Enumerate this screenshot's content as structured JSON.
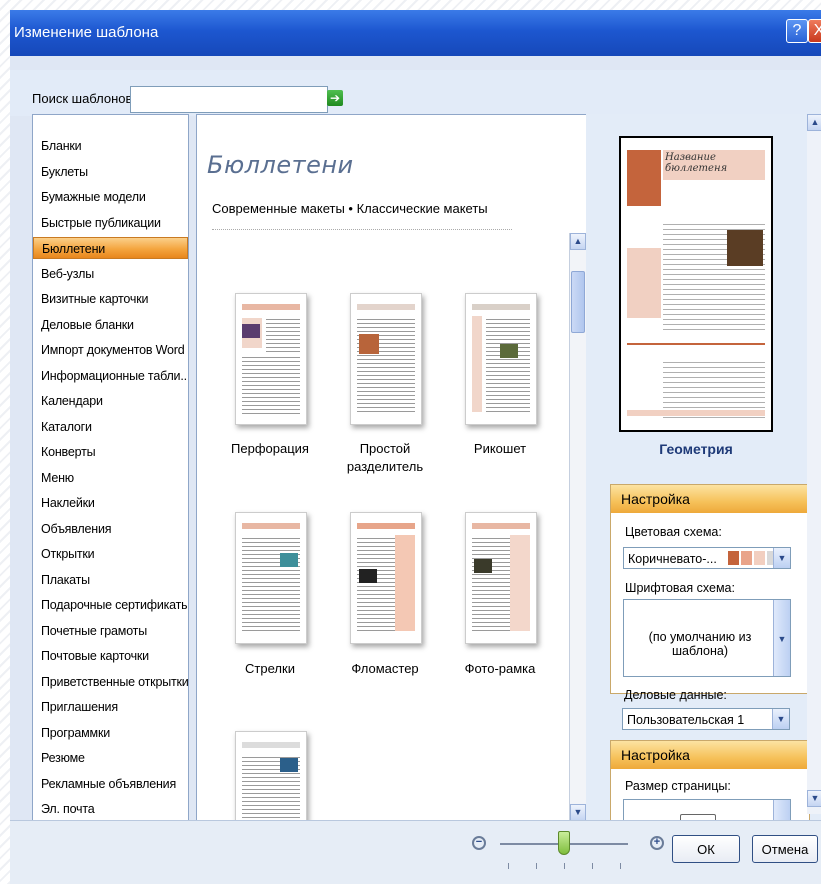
{
  "window": {
    "title": "Изменение шаблона",
    "help_label": "?",
    "close_label": "X"
  },
  "search": {
    "label": "Поиск шаблонов:",
    "value": "",
    "go_label": "➔"
  },
  "categories": [
    "Бланки",
    "Буклеты",
    "Бумажные модели",
    "Быстрые публикации",
    "Бюллетени",
    "Веб-узлы",
    "Визитные карточки",
    "Деловые бланки",
    "Импорт документов Word",
    "Информационные табли...",
    "Календари",
    "Каталоги",
    "Конверты",
    "Меню",
    "Наклейки",
    "Объявления",
    "Открытки",
    "Плакаты",
    "Подарочные сертификаты",
    "Почетные грамоты",
    "Почтовые карточки",
    "Приветственные открытки",
    "Приглашения",
    "Программки",
    "Резюме",
    "Рекламные объявления",
    "Эл. почта"
  ],
  "selected_category": "Бюллетени",
  "gallery": {
    "heading": "Бюллетени",
    "tab_modern": "Современные макеты",
    "tab_sep": "•",
    "tab_classic": "Классические макеты",
    "templates": [
      {
        "line1": "Перфорация",
        "line2": ""
      },
      {
        "line1": "Простой",
        "line2": "разделитель"
      },
      {
        "line1": "Рикошет",
        "line2": ""
      },
      {
        "line1": "Стрелки",
        "line2": ""
      },
      {
        "line1": "Фломастер",
        "line2": ""
      },
      {
        "line1": "Фото-рамка",
        "line2": ""
      },
      {
        "line1": "",
        "line2": ""
      }
    ]
  },
  "preview": {
    "template_name": "Геометрия",
    "newsletter_title": "Название бюллетеня"
  },
  "customize": {
    "header": "Настройка",
    "color_scheme_label": "Цветовая схема:",
    "color_scheme_value": "Коричневато-...",
    "swatch_colors": [
      "#c4643c",
      "#e9a48a",
      "#f2cfc0",
      "#d9d9d9"
    ],
    "font_scheme_label": "Шрифтовая схема:",
    "font_scheme_value": "(по умолчанию из шаблона)",
    "business_info_label": "Деловые данные:",
    "business_info_value": "Пользовательская 1"
  },
  "options": {
    "header": "Настройка",
    "page_size_label": "Размер страницы:"
  },
  "footer": {
    "zoom_out_label": "−",
    "zoom_in_label": "+",
    "zoom_level": 0.5,
    "ok_label": "ОК",
    "cancel_label": "Отмена"
  },
  "icons": {
    "scroll_up": "▲",
    "scroll_down": "▼",
    "dropdown": "▼"
  }
}
